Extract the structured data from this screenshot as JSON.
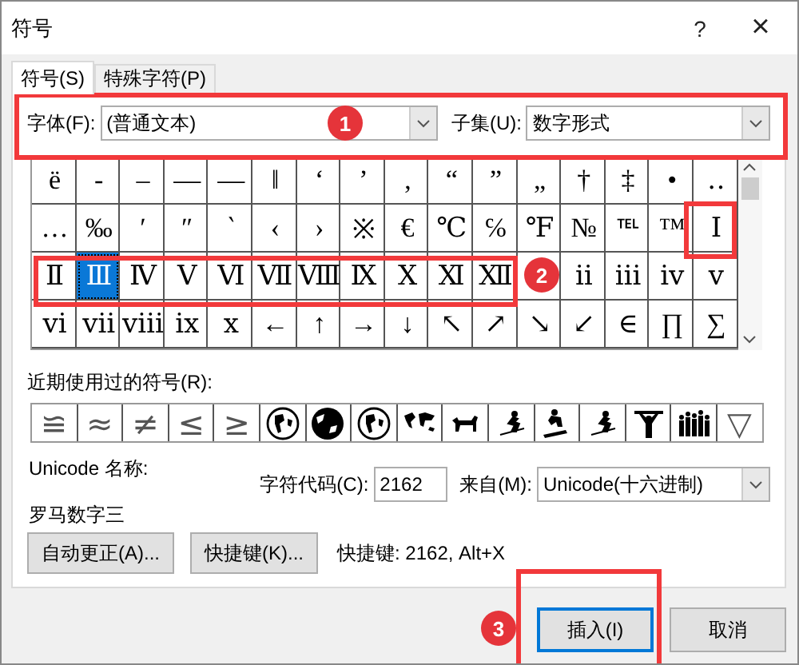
{
  "window": {
    "title": "符号",
    "help": "?",
    "close": "×"
  },
  "tabs": [
    {
      "label": "符号(S)",
      "selected": true
    },
    {
      "label": "特殊字符(P)",
      "selected": false
    }
  ],
  "font": {
    "label": "字体(F):",
    "value": "(普通文本)"
  },
  "subset": {
    "label": "子集(U):",
    "value": "数字形式"
  },
  "symbol_grid": {
    "rows": [
      [
        {
          "char": "ë",
          "selected": false
        },
        {
          "char": "‐",
          "selected": false
        },
        {
          "char": "–",
          "selected": false
        },
        {
          "char": "—",
          "selected": false
        },
        {
          "char": "―",
          "selected": false
        },
        {
          "char": "‖",
          "selected": false
        },
        {
          "char": "‘",
          "selected": false
        },
        {
          "char": "’",
          "selected": false
        },
        {
          "char": "‚",
          "selected": false
        },
        {
          "char": "“",
          "selected": false
        },
        {
          "char": "”",
          "selected": false
        },
        {
          "char": "„",
          "selected": false
        },
        {
          "char": "†",
          "selected": false
        },
        {
          "char": "‡",
          "selected": false
        },
        {
          "char": "•",
          "selected": false
        },
        {
          "char": "‥",
          "selected": false
        }
      ],
      [
        {
          "char": "…",
          "selected": false
        },
        {
          "char": "‰",
          "selected": false
        },
        {
          "char": "′",
          "selected": false
        },
        {
          "char": "″",
          "selected": false
        },
        {
          "char": "‵",
          "selected": false
        },
        {
          "char": "‹",
          "selected": false
        },
        {
          "char": "›",
          "selected": false
        },
        {
          "char": "※",
          "selected": false
        },
        {
          "char": "€",
          "selected": false
        },
        {
          "char": "℃",
          "selected": false
        },
        {
          "char": "℅",
          "selected": false
        },
        {
          "char": "℉",
          "selected": false
        },
        {
          "char": "№",
          "selected": false
        },
        {
          "char": "℡",
          "selected": false
        },
        {
          "char": "™",
          "selected": false
        },
        {
          "char": "Ⅰ",
          "selected": false
        }
      ],
      [
        {
          "char": "Ⅱ",
          "selected": false
        },
        {
          "char": "Ⅲ",
          "selected": true
        },
        {
          "char": "Ⅳ",
          "selected": false
        },
        {
          "char": "Ⅴ",
          "selected": false
        },
        {
          "char": "Ⅵ",
          "selected": false
        },
        {
          "char": "Ⅶ",
          "selected": false
        },
        {
          "char": "Ⅷ",
          "selected": false
        },
        {
          "char": "Ⅸ",
          "selected": false
        },
        {
          "char": "Ⅹ",
          "selected": false
        },
        {
          "char": "Ⅺ",
          "selected": false
        },
        {
          "char": "Ⅻ",
          "selected": false
        },
        null,
        {
          "char": "ⅱ",
          "selected": false
        },
        {
          "char": "ⅲ",
          "selected": false
        },
        {
          "char": "ⅳ",
          "selected": false
        },
        {
          "char": "ⅴ",
          "selected": false
        }
      ],
      [
        {
          "char": "ⅵ",
          "selected": false
        },
        {
          "char": "ⅶ",
          "selected": false
        },
        {
          "char": "ⅷ",
          "selected": false
        },
        {
          "char": "ⅸ",
          "selected": false
        },
        {
          "char": "ⅹ",
          "selected": false
        },
        {
          "char": "←",
          "selected": false
        },
        {
          "char": "↑",
          "selected": false
        },
        {
          "char": "→",
          "selected": false
        },
        {
          "char": "↓",
          "selected": false
        },
        {
          "char": "↖",
          "selected": false
        },
        {
          "char": "↗",
          "selected": false
        },
        {
          "char": "↘",
          "selected": false
        },
        {
          "char": "↙",
          "selected": false
        },
        {
          "char": "∈",
          "selected": false
        },
        {
          "char": "∏",
          "selected": false
        },
        {
          "char": "∑",
          "selected": false
        }
      ]
    ]
  },
  "recent": {
    "label": "近期使用过的符号(R):",
    "items": [
      {
        "kind": "char",
        "char": "≌"
      },
      {
        "kind": "char",
        "char": "≈"
      },
      {
        "kind": "char",
        "char": "≠"
      },
      {
        "kind": "char",
        "char": "≤"
      },
      {
        "kind": "char",
        "char": "≥"
      },
      {
        "kind": "icon"
      },
      {
        "kind": "icon"
      },
      {
        "kind": "icon"
      },
      {
        "kind": "icon"
      },
      {
        "kind": "icon"
      },
      {
        "kind": "icon"
      },
      {
        "kind": "icon"
      },
      {
        "kind": "icon"
      },
      {
        "kind": "icon"
      },
      {
        "kind": "icon"
      },
      {
        "kind": "char",
        "char": "▽"
      }
    ]
  },
  "unicode_name": {
    "label": "Unicode 名称:",
    "value": "罗马数字三"
  },
  "char_code": {
    "label": "字符代码(C):",
    "value": "2162"
  },
  "from": {
    "label": "来自(M):",
    "value": "Unicode(十六进制)"
  },
  "buttons": [
    {
      "label": "自动更正(A)..."
    },
    {
      "label": "快捷键(K)..."
    }
  ],
  "shortcut": "快捷键: 2162, Alt+X",
  "footer_buttons": [
    {
      "label": "插入(I)",
      "default": true
    },
    {
      "label": "取消",
      "default": false
    }
  ],
  "annotations": [
    {
      "number": "1"
    },
    {
      "number": "2"
    },
    {
      "number": "3"
    }
  ]
}
